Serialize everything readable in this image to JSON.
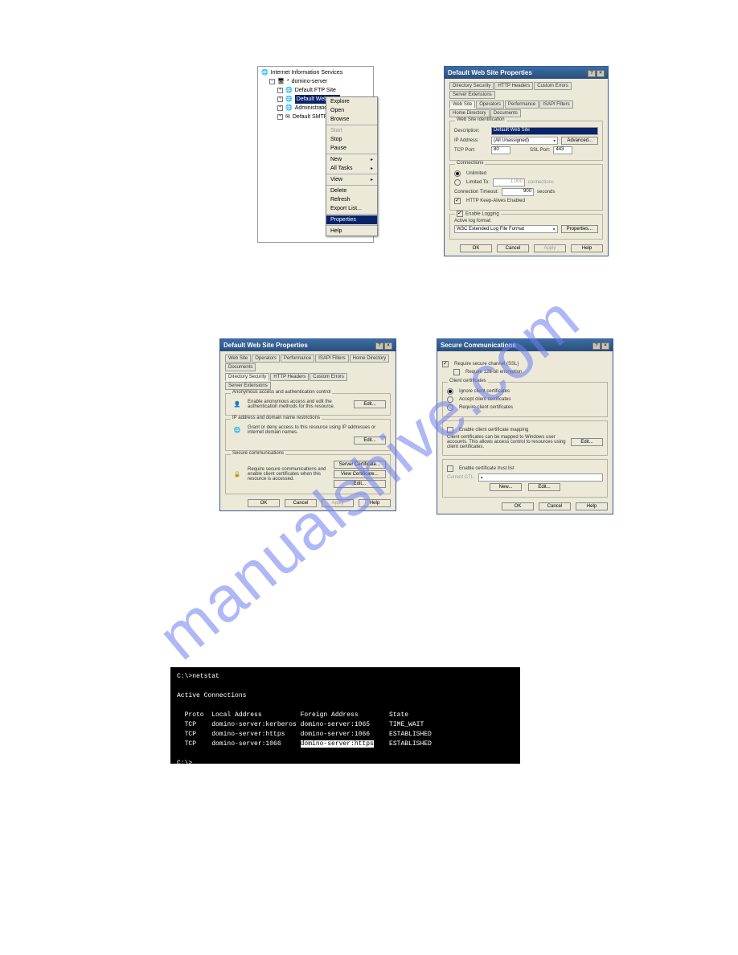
{
  "watermark": "manualshive.com",
  "iis_tree": {
    "root": "Internet Information Services",
    "server": "domino-server",
    "sites": [
      "Default FTP Site",
      "Default Web Site",
      "Administration",
      "Default SMTP V"
    ],
    "selected_index": 1
  },
  "context_menu": {
    "items": [
      {
        "label": "Explore",
        "enabled": true
      },
      {
        "label": "Open",
        "enabled": true
      },
      {
        "label": "Browse",
        "enabled": true
      }
    ],
    "items2": [
      {
        "label": "Start",
        "enabled": false
      },
      {
        "label": "Stop",
        "enabled": true
      },
      {
        "label": "Pause",
        "enabled": true
      }
    ],
    "items3": [
      {
        "label": "New",
        "submenu": true
      },
      {
        "label": "All Tasks",
        "submenu": true
      }
    ],
    "items4": [
      {
        "label": "View",
        "submenu": true
      }
    ],
    "items5": [
      {
        "label": "Delete"
      },
      {
        "label": "Refresh"
      },
      {
        "label": "Export List..."
      }
    ],
    "selected": "Properties",
    "last": "Help"
  },
  "website_props": {
    "title": "Default Web Site Properties",
    "tabs_row1": [
      "Directory Security",
      "HTTP Headers",
      "Custom Errors",
      "Server Extensions"
    ],
    "tabs_row2": [
      "Web Site",
      "Operators",
      "Performance",
      "ISAPI Filters",
      "Home Directory",
      "Documents"
    ],
    "active_tab": "Web Site",
    "identification": {
      "legend": "Web Site Identification",
      "description_label": "Description:",
      "description_value": "Default Web Site",
      "ip_label": "IP Address:",
      "ip_value": "(All Unassigned)",
      "advanced": "Advanced...",
      "tcp_label": "TCP Port:",
      "tcp_value": "80",
      "ssl_label": "SSL Port:",
      "ssl_value": "443"
    },
    "connections": {
      "legend": "Connections",
      "unlimited": "Unlimited",
      "limited": "Limited To:",
      "limited_value": "1,000",
      "limited_unit": "connections",
      "timeout_label": "Connection Timeout:",
      "timeout_value": "900",
      "timeout_unit": "seconds",
      "keepalive": "HTTP Keep-Alives Enabled"
    },
    "logging": {
      "enable": "Enable Logging",
      "format_label": "Active log format:",
      "format_value": "W3C Extended Log File Format",
      "properties": "Properties..."
    },
    "buttons": {
      "ok": "OK",
      "cancel": "Cancel",
      "apply": "Apply",
      "help": "Help"
    }
  },
  "dir_security": {
    "title": "Default Web Site Properties",
    "tabs_row1": [
      "Web Site",
      "Operators",
      "Performance",
      "ISAPI Filters",
      "Home Directory",
      "Documents"
    ],
    "tabs_row2": [
      "Directory Security",
      "HTTP Headers",
      "Custom Errors",
      "Server Extensions"
    ],
    "active_tab": "Directory Security",
    "anon": {
      "legend": "Anonymous access and authentication control",
      "desc": "Enable anonymous access and edit the authentication methods for this resource.",
      "edit": "Edit..."
    },
    "iprestrict": {
      "legend": "IP address and domain name restrictions",
      "desc": "Grant or deny access to this resource using IP addresses or internet domain names.",
      "edit": "Edit..."
    },
    "secure": {
      "legend": "Secure communications",
      "desc": "Require secure communications and enable client certificates when this resource is accessed.",
      "server_cert": "Server Certificate...",
      "view_cert": "View Certificate...",
      "edit": "Edit..."
    },
    "buttons": {
      "ok": "OK",
      "cancel": "Cancel",
      "apply": "Apply",
      "help": "Help"
    }
  },
  "secure_comm": {
    "title": "Secure Communications",
    "require_ssl": "Require secure channel (SSL)",
    "require_128": "Require 128-bit encryption",
    "client_certs": {
      "legend": "Client certificates",
      "ignore": "Ignore client certificates",
      "accept": "Accept client certificates",
      "require": "Require client certificates"
    },
    "mapping": {
      "enable": "Enable client certificate mapping",
      "desc": "Client certificates can be mapped to Windows user accounts. This allows access control to resources using client certificates.",
      "edit": "Edit..."
    },
    "ctl": {
      "enable": "Enable certificate trust list",
      "current": "Current CTL:",
      "new": "New...",
      "edit": "Edit..."
    },
    "buttons": {
      "ok": "OK",
      "cancel": "Cancel",
      "help": "Help"
    }
  },
  "console": {
    "prompt1": "C:\\>netstat",
    "header": "Active Connections",
    "cols": "  Proto  Local Address          Foreign Address        State",
    "rows": [
      "  TCP    domino-server:kerberos domino-server:1065     TIME_WAIT",
      "  TCP    domino-server:https    domino-server:1066     ESTABLISHED"
    ],
    "row_hl_pre": "  TCP    domino-server:1066     ",
    "row_hl_mid": "domino-server:https",
    "row_hl_post": "    ESTABLISHED",
    "prompt2": "C:\\>"
  }
}
